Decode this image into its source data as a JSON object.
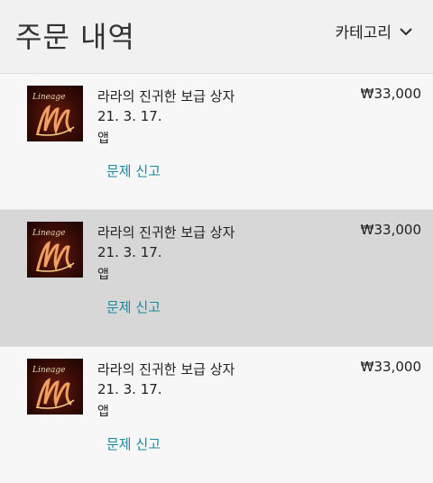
{
  "header": {
    "title": "주문 내역",
    "category_label": "카테고리"
  },
  "orders": [
    {
      "thumb_text": "Lineage",
      "name": "라라의 진귀한 보급 상자",
      "price": "₩33,000",
      "date": "21. 3. 17.",
      "type": "앱",
      "report": "문제 신고"
    },
    {
      "thumb_text": "Lineage",
      "name": "라라의 진귀한 보급 상자",
      "price": "₩33,000",
      "date": "21. 3. 17.",
      "type": "앱",
      "report": "문제 신고"
    },
    {
      "thumb_text": "Lineage",
      "name": "라라의 진귀한 보급 상자",
      "price": "₩33,000",
      "date": "21. 3. 17.",
      "type": "앱",
      "report": "문제 신고"
    }
  ],
  "colors": {
    "link": "#1a8a9c",
    "selected_row": "#d7d7d7",
    "background": "#f7f7f7"
  }
}
